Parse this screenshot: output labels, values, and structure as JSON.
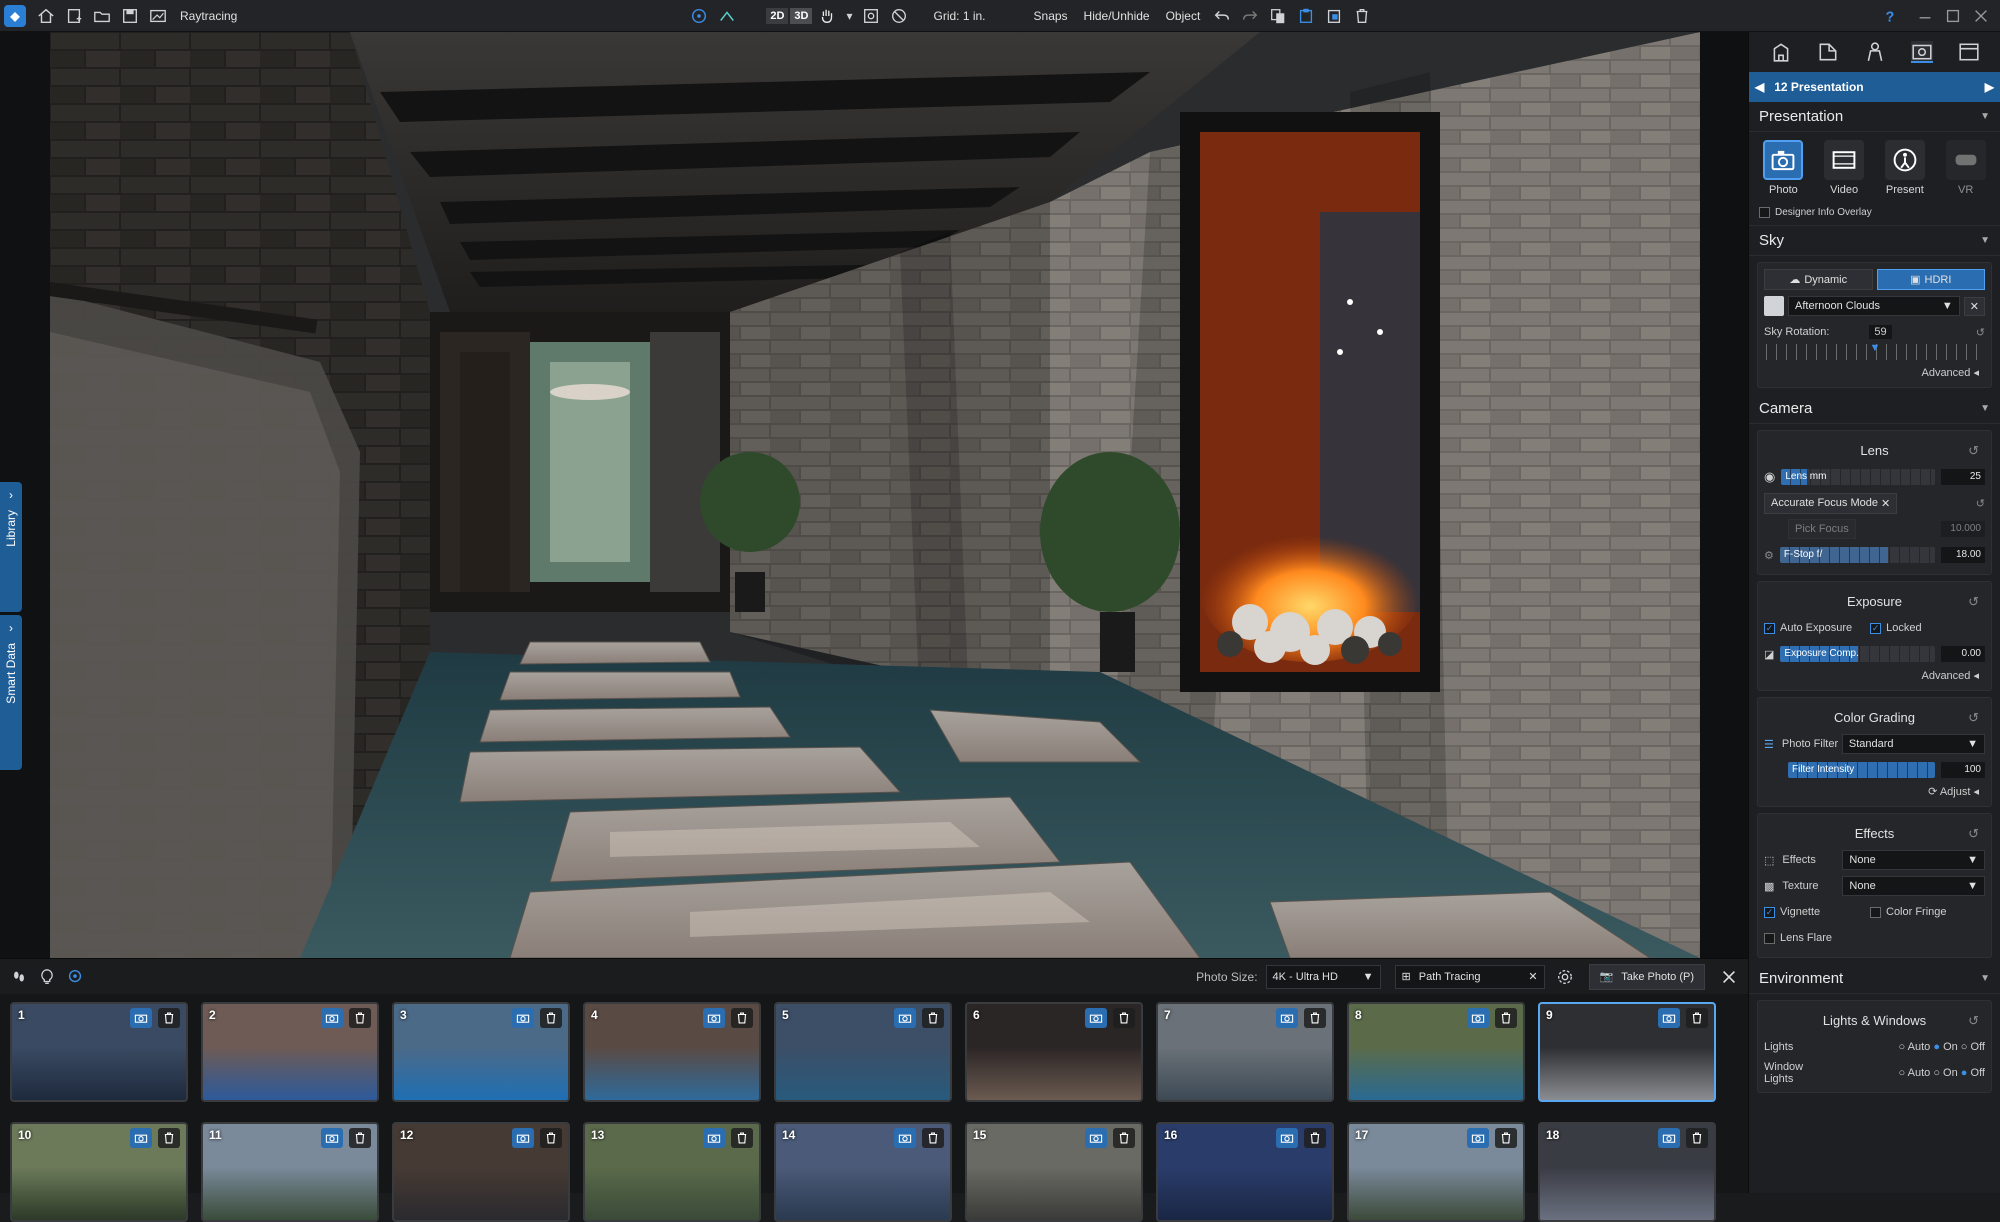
{
  "toolbar": {
    "raytracing_label": "Raytracing",
    "view_2d": "2D",
    "view_3d": "3D",
    "grid_label": "Grid: 1 in.",
    "snaps_label": "Snaps",
    "hide_unhide_label": "Hide/Unhide",
    "object_label": "Object"
  },
  "left_tabs": {
    "library": "Library",
    "smart_data": "Smart Data"
  },
  "panel": {
    "banner_title": "12 Presentation",
    "presentation": {
      "title": "Presentation",
      "modes": [
        "Photo",
        "Video",
        "Present",
        "VR"
      ],
      "designer_overlay_label": "Designer Info Overlay"
    },
    "sky": {
      "title": "Sky",
      "dynamic_label": "Dynamic",
      "hdri_label": "HDRI",
      "hdri_value": "Afternoon Clouds",
      "rotation_label": "Sky Rotation:",
      "rotation_value": "59",
      "rotation_fraction": 0.5,
      "advanced_label": "Advanced"
    },
    "camera": {
      "title": "Camera",
      "lens_title": "Lens",
      "lens_label": "Lens mm",
      "lens_value": "25",
      "lens_fraction": 0.17,
      "focus_mode_label": "Accurate Focus Mode",
      "pick_focus_label": "Pick Focus",
      "pick_focus_value": "10.000",
      "fstop_label": "F-Stop f/",
      "fstop_value": "18.00",
      "fstop_fraction": 0.7,
      "exposure_title": "Exposure",
      "auto_exposure_label": "Auto Exposure",
      "locked_label": "Locked",
      "exposure_comp_label": "Exposure Comp.",
      "exposure_comp_value": "0.00",
      "exposure_comp_fraction": 0.5,
      "advanced_label": "Advanced",
      "color_grading_title": "Color Grading",
      "photo_filter_label": "Photo Filter",
      "photo_filter_value": "Standard",
      "filter_intensity_label": "Filter Intensity",
      "filter_intensity_value": "100",
      "filter_intensity_fraction": 1.0,
      "adjust_label": "Adjust",
      "effects_title": "Effects",
      "effects_label": "Effects",
      "effects_value": "None",
      "texture_label": "Texture",
      "texture_value": "None",
      "vignette_label": "Vignette",
      "color_fringe_label": "Color Fringe",
      "lens_flare_label": "Lens Flare"
    },
    "environment": {
      "title": "Environment",
      "lights_windows_title": "Lights & Windows",
      "lights_label": "Lights",
      "window_lights_label": "Window Lights",
      "options": [
        "Auto",
        "On",
        "Off"
      ]
    }
  },
  "bottom": {
    "photo_size_label": "Photo Size:",
    "photo_size_value": "4K - Ultra HD",
    "render_mode_value": "Path Tracing",
    "take_photo_label": "Take Photo (P)"
  },
  "thumbnails": [
    {
      "n": "1",
      "c1": "#3a4a62",
      "c2": "#1e2a3d"
    },
    {
      "n": "2",
      "c1": "#6e5b55",
      "c2": "#2d5a9a"
    },
    {
      "n": "3",
      "c1": "#4b6a88",
      "c2": "#1f6fb3"
    },
    {
      "n": "4",
      "c1": "#5a4a44",
      "c2": "#2f6a9a"
    },
    {
      "n": "5",
      "c1": "#3c4f67",
      "c2": "#285a7c"
    },
    {
      "n": "6",
      "c1": "#2b2626",
      "c2": "#6b5a50"
    },
    {
      "n": "7",
      "c1": "#6a7178",
      "c2": "#3d4a55"
    },
    {
      "n": "8",
      "c1": "#5b6b4a",
      "c2": "#2a6a92"
    },
    {
      "n": "9",
      "c1": "#2e2f33",
      "c2": "#8a8d91"
    },
    {
      "n": "10",
      "c1": "#6c7a5a",
      "c2": "#2c3a28"
    },
    {
      "n": "11",
      "c1": "#7a8a9a",
      "c2": "#3a4c3a"
    },
    {
      "n": "12",
      "c1": "#463a34",
      "c2": "#2a2a2e"
    },
    {
      "n": "13",
      "c1": "#5a6a4a",
      "c2": "#3a4a38"
    },
    {
      "n": "14",
      "c1": "#4a5a78",
      "c2": "#2a3a50"
    },
    {
      "n": "15",
      "c1": "#6a6a64",
      "c2": "#3a3a38"
    },
    {
      "n": "16",
      "c1": "#2a3c6a",
      "c2": "#1a2644"
    },
    {
      "n": "17",
      "c1": "#7a8a9a",
      "c2": "#3c4a3a"
    },
    {
      "n": "18",
      "c1": "#3a3c44",
      "c2": "#6a7080"
    }
  ]
}
